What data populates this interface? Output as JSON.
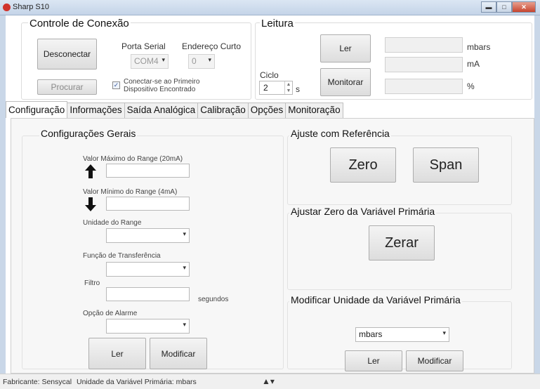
{
  "window": {
    "title": "Sharp S10"
  },
  "connection": {
    "title": "Controle de Conexão",
    "disconnect_label": "Desconectar",
    "search_label": "Procurar",
    "serial_port_label": "Porta Serial",
    "serial_port_value": "COM4",
    "short_address_label": "Endereço Curto",
    "short_address_value": "0",
    "auto_connect_label_line1": "Conectar-se ao Primeiro",
    "auto_connect_label_line2": "Dispositivo Encontrado",
    "auto_connect_checked": true
  },
  "reading": {
    "title": "Leitura",
    "read_label": "Ler",
    "monitor_label": "Monitorar",
    "cycle_label": "Ciclo",
    "cycle_value": "2",
    "cycle_unit": "s",
    "units": [
      "mbars",
      "mA",
      "%"
    ]
  },
  "tabs": [
    "Configuração",
    "Informações",
    "Saída Analógica",
    "Calibração",
    "Opções",
    "Monitoração"
  ],
  "general": {
    "title": "Configurações Gerais",
    "max_range_label": "Valor Máximo do Range (20mA)",
    "min_range_label": "Valor Mínimo do Range (4mA)",
    "range_unit_label": "Unidade do Range",
    "transfer_function_label": "Função de Transferência",
    "filter_label": "Filtro",
    "filter_unit": "segundos",
    "alarm_option_label": "Opção de Alarme",
    "read_label": "Ler",
    "modify_label": "Modificar"
  },
  "reference": {
    "title": "Ajuste com Referência",
    "zero_label": "Zero",
    "span_label": "Span"
  },
  "primary_zero": {
    "title": "Ajustar Zero da Variável Primária",
    "zero_label": "Zerar"
  },
  "primary_unit": {
    "title": "Modificar Unidade da Variável Primária",
    "selected": "mbars",
    "read_label": "Ler",
    "modify_label": "Modificar"
  },
  "status": {
    "manufacturer": "Fabricante: Sensycal",
    "primary_unit": "Unidade da Variável Primária: mbars"
  }
}
